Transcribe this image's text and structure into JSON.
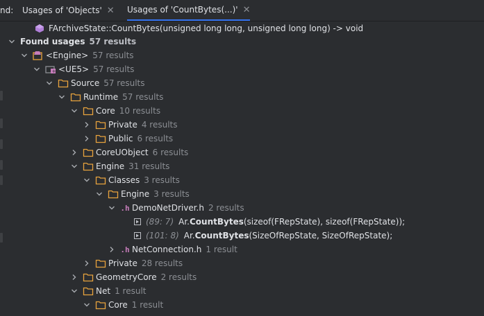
{
  "tabs": {
    "prefix": "nd:",
    "items": [
      {
        "label": "Usages of 'Objects'"
      },
      {
        "label": "Usages of 'CountBytes(...)'"
      }
    ]
  },
  "target": {
    "label": "FArchiveState::CountBytes(unsigned long long, unsigned long long) -> void"
  },
  "tree": {
    "found": {
      "label": "Found usages",
      "count": "57 results"
    },
    "engine": {
      "label": "<Engine>",
      "count": "57 results"
    },
    "ue5": {
      "label": "<UE5>",
      "count": "57 results"
    },
    "source": {
      "label": "Source",
      "count": "57 results"
    },
    "runtime": {
      "label": "Runtime",
      "count": "57 results"
    },
    "core": {
      "label": "Core",
      "count": "10 results"
    },
    "core_private": {
      "label": "Private",
      "count": "4 results"
    },
    "core_public": {
      "label": "Public",
      "count": "6 results"
    },
    "coreuobject": {
      "label": "CoreUObject",
      "count": "6 results"
    },
    "engine_mod": {
      "label": "Engine",
      "count": "31 results"
    },
    "classes": {
      "label": "Classes",
      "count": "3 results"
    },
    "engine_sub": {
      "label": "Engine",
      "count": "3 results"
    },
    "demo": {
      "label": "DemoNetDriver.h",
      "count": "2 results",
      "ext": ".h"
    },
    "usage1": {
      "loc": "(89: 7)",
      "pre": "Ar.",
      "match": "CountBytes",
      "post": "(sizeof(FRepState), sizeof(FRepState));"
    },
    "usage2": {
      "loc": "(101: 8)",
      "pre": "Ar.",
      "match": "CountBytes",
      "post": "(SizeOfRepState, SizeOfRepState);"
    },
    "netconn": {
      "label": "NetConnection.h",
      "count": "1 result",
      "ext": ".h"
    },
    "engine_private": {
      "label": "Private",
      "count": "28 results"
    },
    "geometrycore": {
      "label": "GeometryCore",
      "count": "2 results"
    },
    "net": {
      "label": "Net",
      "count": "1 result"
    },
    "net_core": {
      "label": "Core",
      "count": "1 result"
    }
  },
  "colors": {
    "background": "#2b2d30",
    "folder": "#e8a33d",
    "accent": "#3574f0",
    "count": "#8c8f94"
  }
}
